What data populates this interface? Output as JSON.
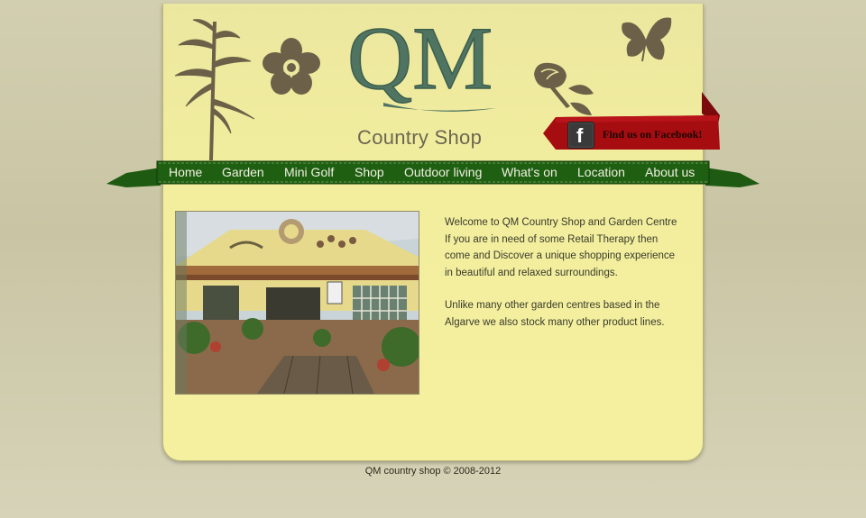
{
  "brand": {
    "logo_text": "QM",
    "subtitle": "Country Shop"
  },
  "facebook": {
    "label": "Find us on Facebook!",
    "icon": "facebook-icon"
  },
  "nav": {
    "items": [
      {
        "label": "Home"
      },
      {
        "label": "Garden"
      },
      {
        "label": "Mini Golf"
      },
      {
        "label": "Shop"
      },
      {
        "label": "Outdoor living"
      },
      {
        "label": "What's on"
      },
      {
        "label": "Location"
      },
      {
        "label": "About us"
      }
    ]
  },
  "content": {
    "paragraphs": [
      "Welcome to QM Country Shop and Garden Centre If you are in need of some Retail Therapy then come and Discover a unique shopping experience in beautiful and relaxed surroundings.",
      "Unlike many other garden centres based in the Algarve we also stock many other product lines."
    ]
  },
  "footer": {
    "copyright": "QM country shop © 2008-2012"
  },
  "colors": {
    "page_bg": "#f2ee9e",
    "nav_green": "#1e5a12",
    "logo_green": "#4f7562",
    "facebook_red": "#a50d11",
    "deco_brown": "#6c6148"
  }
}
